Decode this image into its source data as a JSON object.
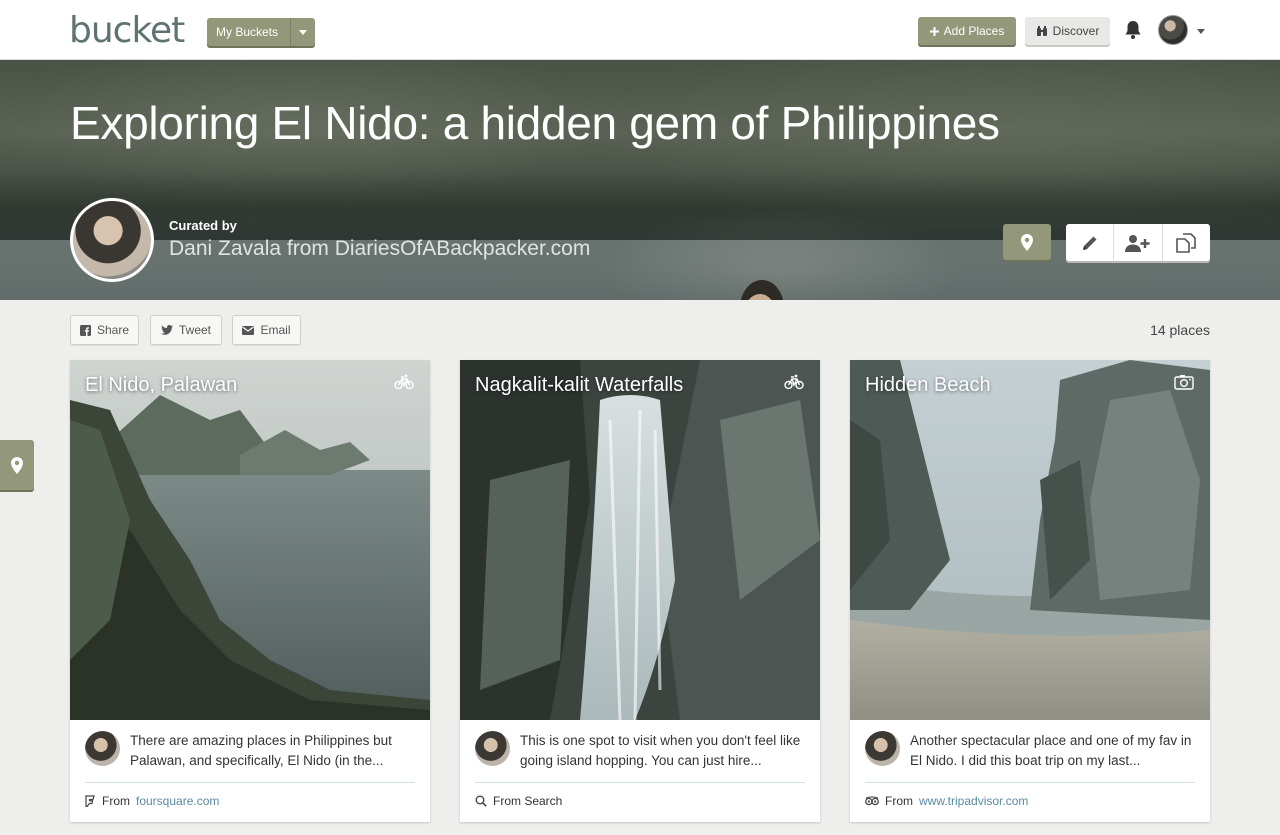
{
  "nav": {
    "logo": "bucket",
    "my_buckets": "My Buckets",
    "add_places": "Add Places",
    "discover": "Discover"
  },
  "hero": {
    "title": "Exploring El Nido: a hidden gem of Philippines",
    "curated_by": "Curated by",
    "curator": "Dani Zavala from DiariesOfABackpacker.com"
  },
  "share": {
    "share": "Share",
    "tweet": "Tweet",
    "email": "Email",
    "places_count": "14 places"
  },
  "cards": [
    {
      "title": "El Nido, Palawan",
      "type_icon": "bicycle-icon",
      "description": "There are amazing places in Philippines but Palawan, and specifically, El Nido (in the...",
      "source_prefix": "From",
      "source": "foursquare.com",
      "source_icon": "foursquare-icon"
    },
    {
      "title": "Nagkalit-kalit Waterfalls",
      "type_icon": "bicycle-icon",
      "description": "This is one spot to visit when you don't feel like going island hopping. You can just hire...",
      "source_prefix": "From Search",
      "source": "",
      "source_icon": "search-icon"
    },
    {
      "title": "Hidden Beach",
      "type_icon": "camera-icon",
      "description": "Another spectacular place and one of my fav in El Nido. I did this boat trip on my last...",
      "source_prefix": "From",
      "source": "www.tripadvisor.com",
      "source_icon": "tripadvisor-icon"
    }
  ],
  "colors": {
    "olive": "#93987a",
    "link": "#5a8aa0",
    "background": "#eeeeec"
  }
}
